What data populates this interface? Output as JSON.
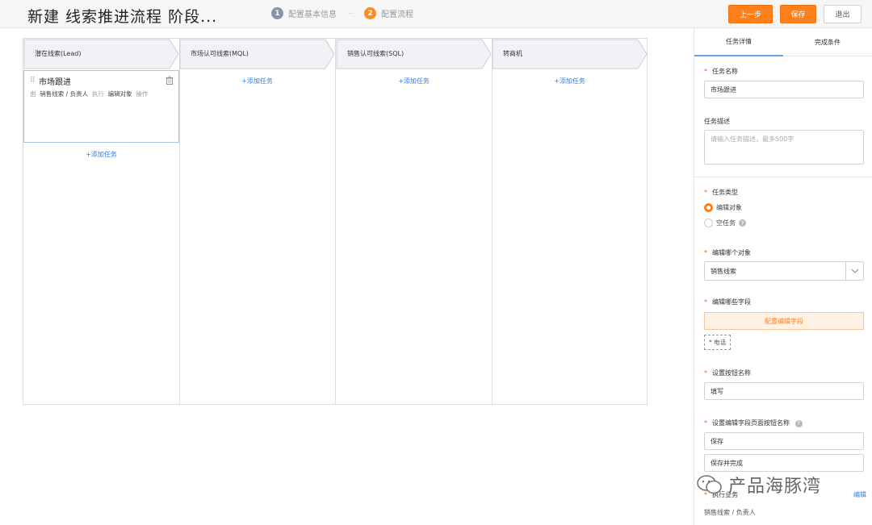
{
  "header": {
    "title": "新建 线索推进流程 阶段...",
    "steps": [
      {
        "num": "1",
        "label": "配置基本信息"
      },
      {
        "num": "2",
        "label": "配置流程"
      }
    ],
    "step_separator": "..",
    "buttons": {
      "prev": "上一步",
      "save": "保存",
      "exit": "退出"
    }
  },
  "board": {
    "columns": [
      {
        "stage": "潜在线索(Lead)",
        "add_task": "+添加任务"
      },
      {
        "stage": "市场认可线索(MQL)",
        "add_task": "+添加任务"
      },
      {
        "stage": "销售认可线索(SQL)",
        "add_task": "+添加任务"
      },
      {
        "stage": "转商机",
        "add_task": "+添加任务"
      }
    ],
    "task_card": {
      "name": "市场跟进",
      "meta_prefix": "由",
      "meta_owner": "销售线索 / 负责人",
      "meta_exec": "执行",
      "meta_action": "编辑对象",
      "meta_op": "操作"
    }
  },
  "panel": {
    "tabs": [
      "任务详情",
      "完成条件"
    ],
    "task_name": {
      "label": "任务名称",
      "value": "市场跟进"
    },
    "task_desc": {
      "label": "任务描述",
      "placeholder": "请输入任务描述，最多500字"
    },
    "task_type": {
      "label": "任务类型",
      "options": [
        "编辑对象",
        "空任务"
      ]
    },
    "edit_object": {
      "label": "编辑哪个对象",
      "value": "销售线索"
    },
    "edit_fields": {
      "label": "编辑哪些字段",
      "button": "配置编辑字段",
      "tag": "* 电话"
    },
    "button_name": {
      "label": "设置按钮名称",
      "value": "填写"
    },
    "edit_page_buttons": {
      "label": "设置编辑字段页面按钮名称",
      "values": [
        "保存",
        "保存并完成"
      ]
    },
    "executor": {
      "label": "执行业务",
      "edit_link": "编辑",
      "value": "销售线索 / 负责人"
    }
  },
  "watermark": {
    "text": "产品海豚湾"
  },
  "colors": {
    "accent": "#ff7f1a",
    "link": "#3a7be0",
    "stage_fill": "#f0f2f5",
    "stage_border": "#c9cfd8"
  }
}
